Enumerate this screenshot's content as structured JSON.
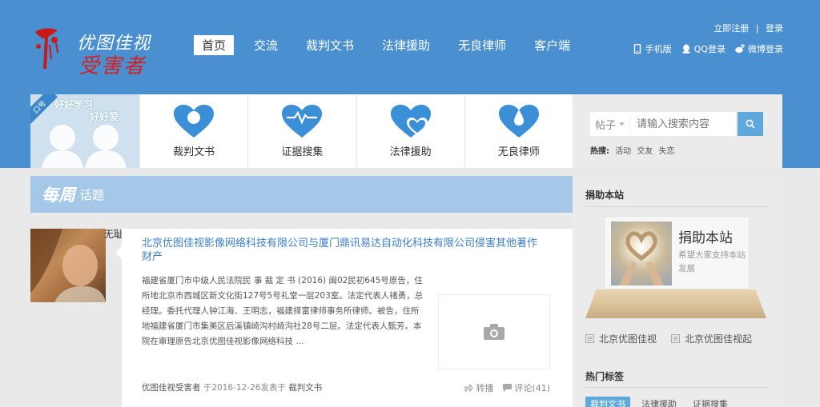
{
  "header": {
    "logo_line1": "优图佳视",
    "logo_line2": "受害者",
    "nav": [
      "首页",
      "交流",
      "裁判文书",
      "法律援助",
      "无良律师",
      "客户端"
    ],
    "register": "立即注册",
    "separator": "|",
    "login": "登录",
    "links": [
      "手机版",
      "QQ登录",
      "微博登录"
    ]
  },
  "slogan": {
    "tag": "口号",
    "line1": "好好学习",
    "line2": "好好爱"
  },
  "features": [
    {
      "label": "裁判文书",
      "icon": "circle-heart-icon"
    },
    {
      "label": "证据搜集",
      "icon": "pulse-heart-icon"
    },
    {
      "label": "法律援助",
      "icon": "double-heart-icon"
    },
    {
      "label": "无良律师",
      "icon": "drop-heart-icon"
    }
  ],
  "search": {
    "category": "帖子",
    "placeholder": "请输入搜索内容",
    "hot_label": "热搜:",
    "hot_terms": [
      "活动",
      "交友",
      "失恋"
    ]
  },
  "weekly": {
    "big": "每周",
    "small": "话题"
  },
  "thumb_cut": "无耻",
  "article": {
    "title": "北京优图佳视影像网络科技有限公司与厦门鼎讯易达自动化科技有限公司侵害其他著作财产",
    "body": "福建省厦门市中级人民法院民 事 裁 定 书 (2016) 闽02民初645号原告，住所地北京市西城区新文化街127号5号礼堂一层203室。法定代表人禇勇，总经理。委托代理人钟江海、王明志，福建择富律师事务所律师。被告，住所地福建省厦门市集美区后溪镇崎沟村崎沟社28号二层。法定代表人甄芳。本院在审理原告北京优图佳视影像网络科技 ...",
    "author": "优图佳视受害者",
    "at": "于",
    "date": "2016-12-26",
    "posted_in": "发表于",
    "category": "裁判文书",
    "share": "转播",
    "comments": "评论(41)"
  },
  "sidebar": {
    "donate_heading": "捐助本站",
    "donate_title": "捐助本站",
    "donate_sub": "希望大家支持本站发展",
    "links": [
      "北京优图佳视",
      "北京优图佳视起"
    ],
    "tags_heading": "热门标签",
    "tags": [
      "裁判文书",
      "法律援助",
      "证据搜集"
    ]
  },
  "colors": {
    "brand_blue": "#4a90d0",
    "heart_blue": "#3b8fd6",
    "accent_red": "#d42020"
  }
}
